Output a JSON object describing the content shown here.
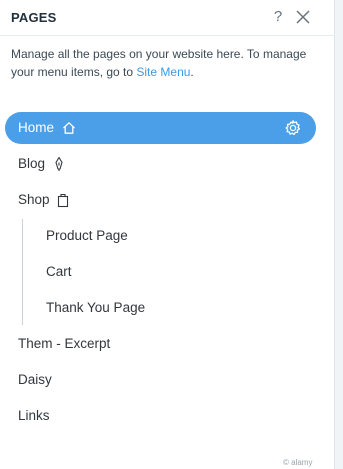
{
  "panel": {
    "title": "PAGES",
    "help_label": "?",
    "description_text": "Manage all the pages on your website here. To manage your menu items, go to ",
    "description_link": "Site Menu",
    "description_end": "."
  },
  "pages": [
    {
      "label": "Home",
      "icon": "home-icon",
      "selected": true
    },
    {
      "label": "Blog",
      "icon": "pen-icon"
    },
    {
      "label": "Shop",
      "icon": "shopping-bag-icon"
    },
    {
      "label": "Product Page",
      "level": 1
    },
    {
      "label": "Cart",
      "level": 1
    },
    {
      "label": "Thank You Page",
      "level": 1
    },
    {
      "label": "Them - Excerpt"
    },
    {
      "label": "Daisy"
    },
    {
      "label": "Links"
    }
  ],
  "watermark": "© alamy",
  "colors": {
    "accent": "#4b9ee8",
    "link": "#3899ec",
    "text": "#32373c"
  }
}
